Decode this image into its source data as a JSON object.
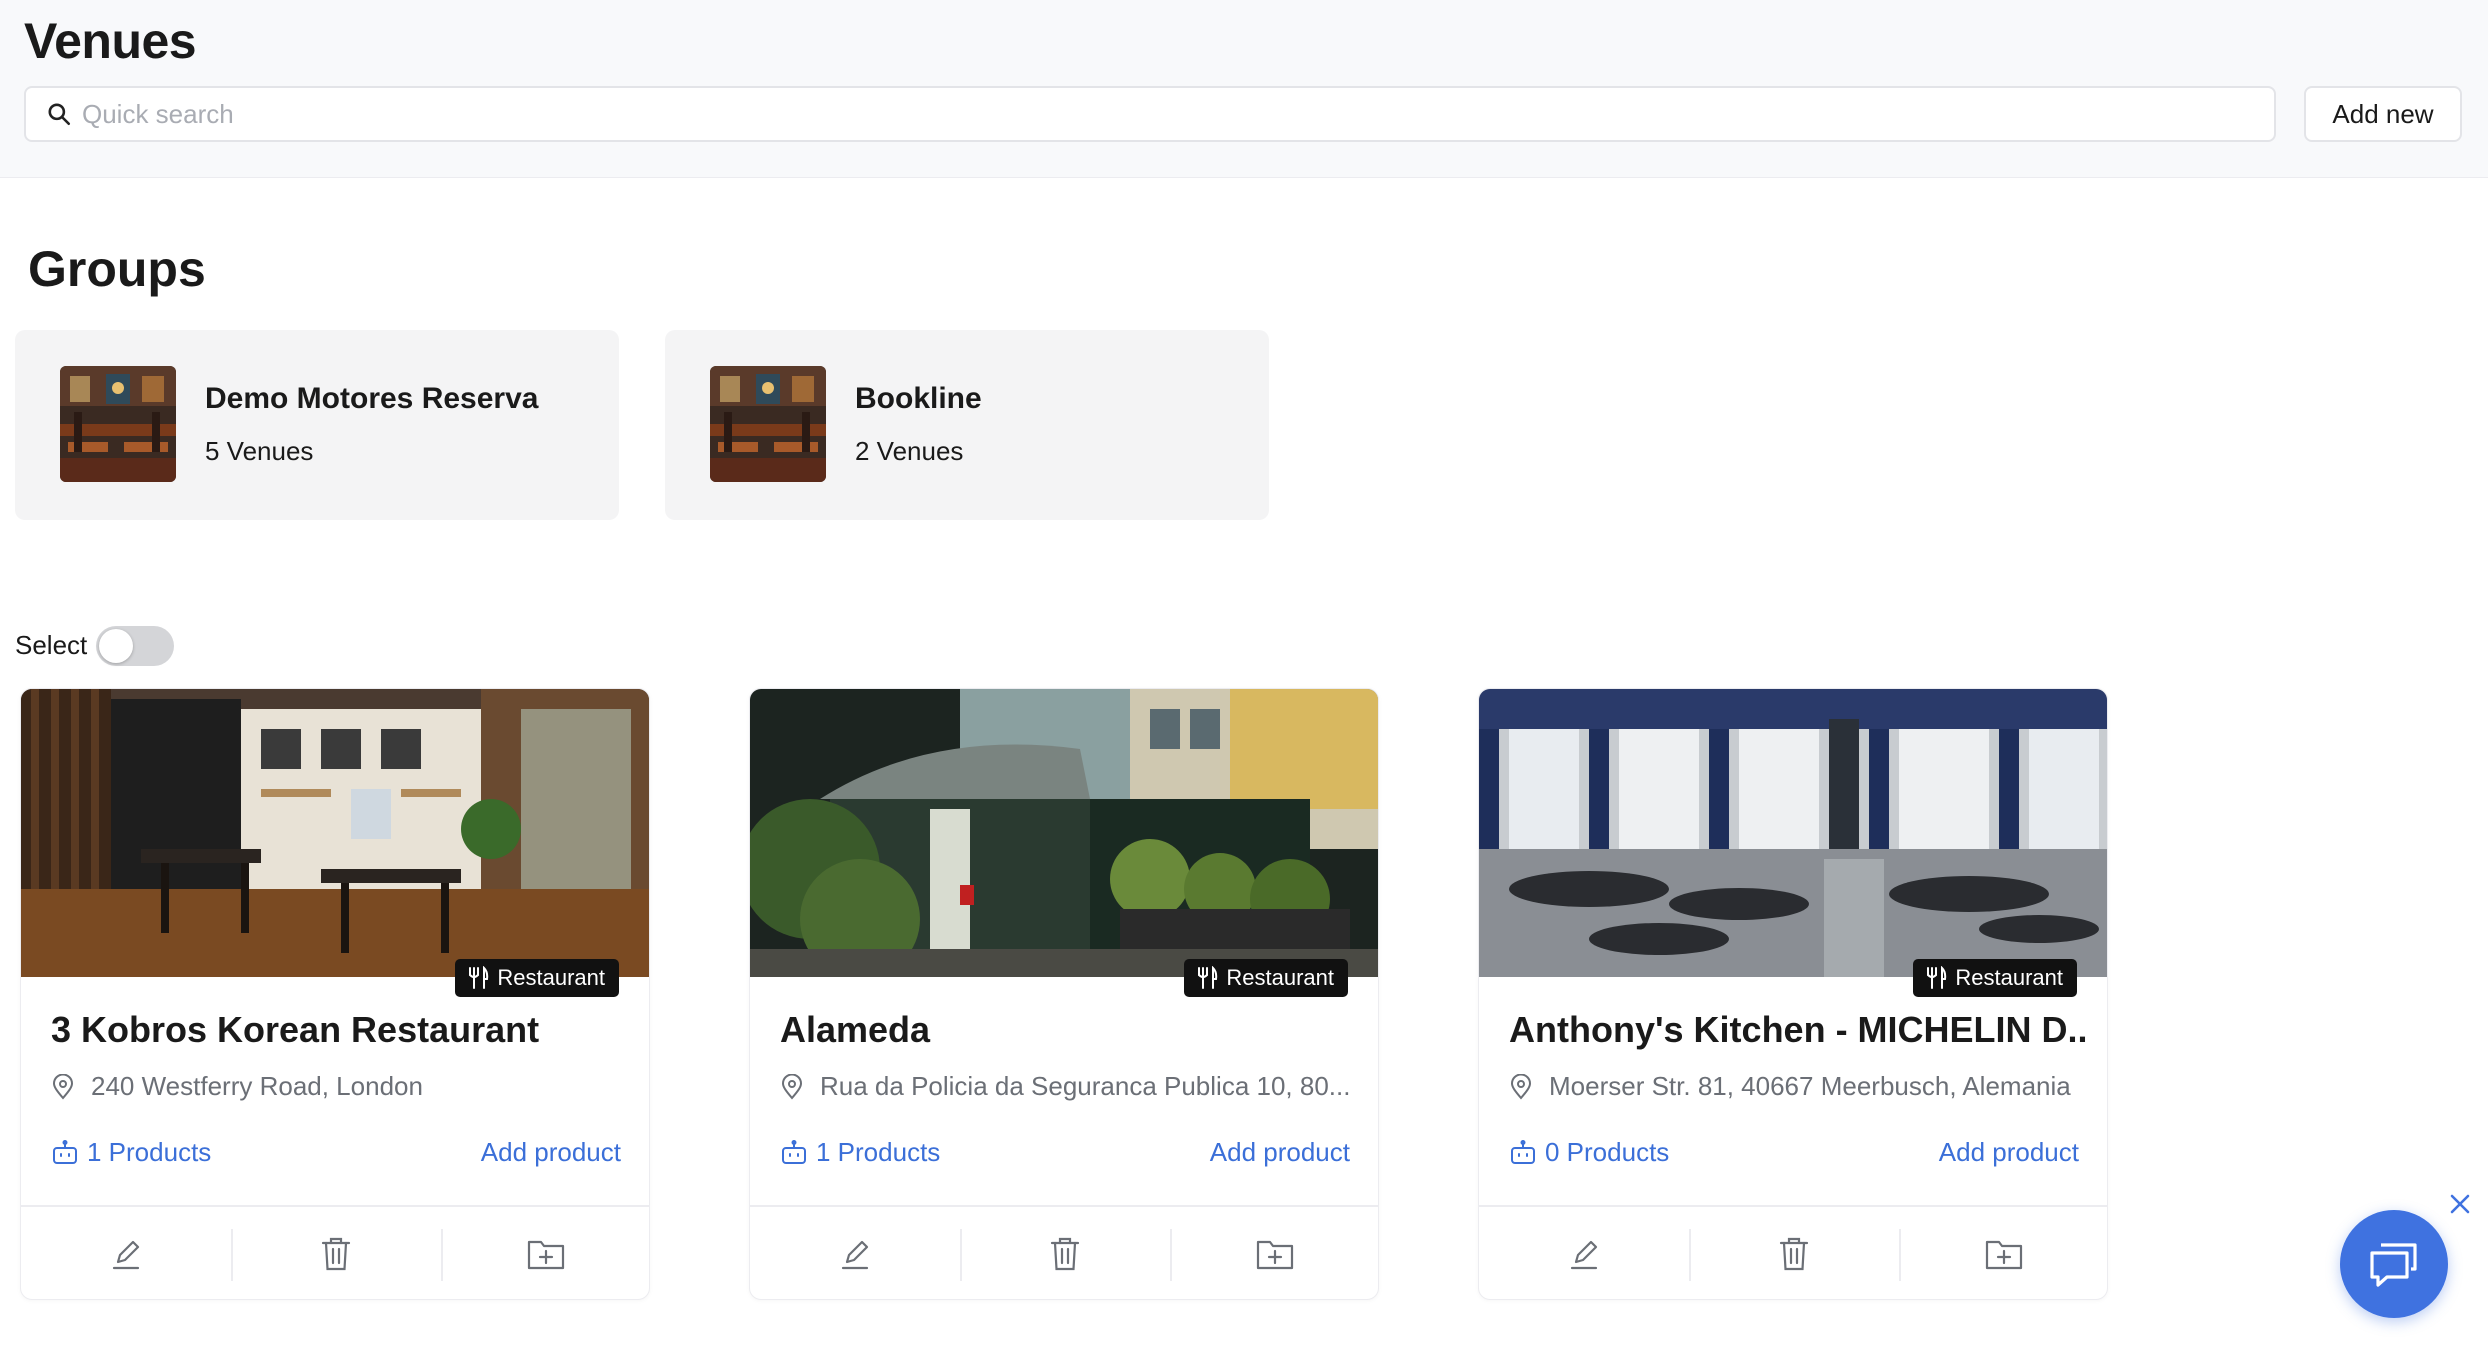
{
  "header": {
    "title": "Venues",
    "search_placeholder": "Quick search",
    "search_value": "",
    "add_new_label": "Add new"
  },
  "groups": {
    "title": "Groups",
    "items": [
      {
        "name": "Demo Motores Reserva",
        "count": "5 Venues"
      },
      {
        "name": "Bookline",
        "count": "2 Venues"
      }
    ]
  },
  "select": {
    "label": "Select",
    "enabled": false
  },
  "venues": [
    {
      "badge": "Restaurant",
      "name": "3 Kobros Korean Restaurant",
      "address": "240 Westferry Road, London",
      "products": "1 Products",
      "add_product": "Add product"
    },
    {
      "badge": "Restaurant",
      "name": "Alameda",
      "address": "Rua da Policia da Seguranca Publica 10, 80...",
      "products": "1 Products",
      "add_product": "Add product"
    },
    {
      "badge": "Restaurant",
      "name": "Anthony's Kitchen - MICHELIN D...",
      "address": "Moerser Str. 81, 40667 Meerbusch, Alemania",
      "products": "0 Products",
      "add_product": "Add product"
    }
  ],
  "icons": {
    "search": "search-icon",
    "restaurant": "fork-knife-icon",
    "location": "location-pin-icon",
    "product": "robot-icon",
    "edit": "pencil-icon",
    "delete": "trash-icon",
    "add_to_folder": "folder-plus-icon",
    "chat": "chat-icon",
    "close": "close-icon"
  },
  "colors": {
    "accent": "#3b6fd8",
    "chat_button": "#3f72e0",
    "badge_bg": "#111111"
  }
}
